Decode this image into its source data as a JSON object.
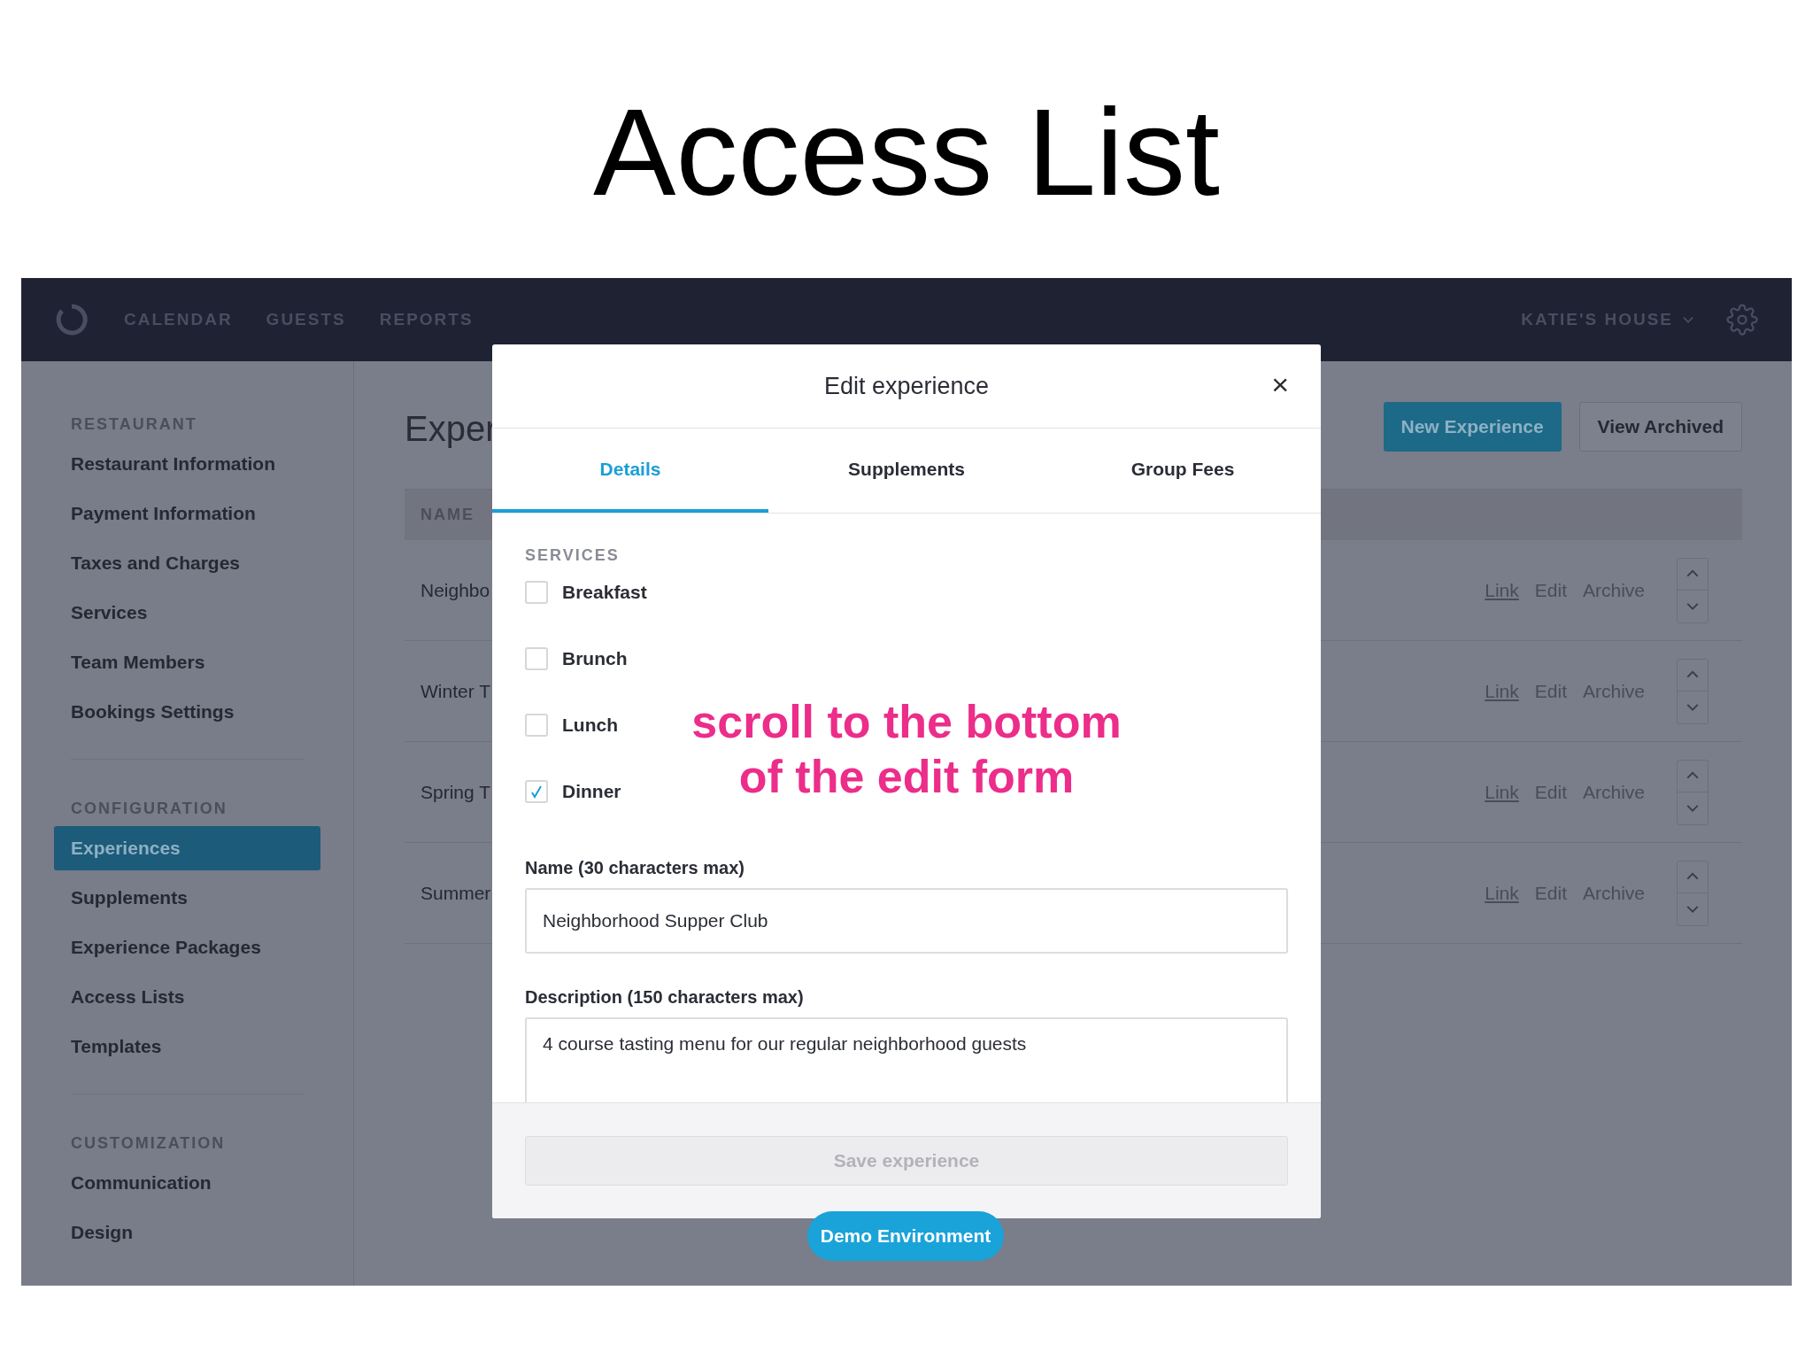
{
  "slide_title": "Access List",
  "annotation": {
    "lines": [
      "scroll to the bottom",
      "of the edit form"
    ]
  },
  "nav": {
    "items": [
      "CALENDAR",
      "GUESTS",
      "REPORTS"
    ],
    "account": "KATIE'S HOUSE"
  },
  "sidebar": {
    "sections": [
      {
        "heading": "RESTAURANT",
        "items": [
          {
            "label": "Restaurant Information",
            "selected": false
          },
          {
            "label": "Payment Information",
            "selected": false
          },
          {
            "label": "Taxes and Charges",
            "selected": false
          },
          {
            "label": "Services",
            "selected": false
          },
          {
            "label": "Team Members",
            "selected": false
          },
          {
            "label": "Bookings Settings",
            "selected": false
          }
        ]
      },
      {
        "heading": "CONFIGURATION",
        "items": [
          {
            "label": "Experiences",
            "selected": true
          },
          {
            "label": "Supplements",
            "selected": false
          },
          {
            "label": "Experience Packages",
            "selected": false
          },
          {
            "label": "Access Lists",
            "selected": false
          },
          {
            "label": "Templates",
            "selected": false
          }
        ]
      },
      {
        "heading": "CUSTOMIZATION",
        "items": [
          {
            "label": "Communication",
            "selected": false
          },
          {
            "label": "Design",
            "selected": false
          }
        ]
      }
    ]
  },
  "page": {
    "title": "Exper",
    "buttons": [
      {
        "label": "New Experience",
        "kind": "primary"
      },
      {
        "label": "View Archived",
        "kind": "secondary"
      }
    ],
    "table": {
      "columns": [
        "NAME"
      ],
      "rows": [
        {
          "name": "Neighbo",
          "actions": [
            "Link",
            "Edit",
            "Archive"
          ]
        },
        {
          "name": "Winter T",
          "actions": [
            "Link",
            "Edit",
            "Archive"
          ]
        },
        {
          "name": "Spring T",
          "actions": [
            "Link",
            "Edit",
            "Archive"
          ]
        },
        {
          "name": "Summer",
          "actions": [
            "Link",
            "Edit",
            "Archive"
          ]
        }
      ]
    }
  },
  "modal": {
    "title": "Edit experience",
    "close": "×",
    "tabs": [
      {
        "label": "Details",
        "selected": true
      },
      {
        "label": "Supplements",
        "selected": false
      },
      {
        "label": "Group Fees",
        "selected": false
      }
    ],
    "section_heading": "SERVICES",
    "services": [
      {
        "label": "Breakfast",
        "checked": false
      },
      {
        "label": "Brunch",
        "checked": false
      },
      {
        "label": "Lunch",
        "checked": false
      },
      {
        "label": "Dinner",
        "checked": true
      }
    ],
    "fields": [
      {
        "label": "Name (30 characters max)",
        "value": "Neighborhood Supper Club",
        "kind": "input"
      },
      {
        "label": "Description (150 characters max)",
        "value": "4 course tasting menu for our regular neighborhood guests",
        "kind": "textarea"
      }
    ],
    "save_button": {
      "label": "Save experience",
      "disabled": true
    }
  },
  "demo_badge": "Demo Environment"
}
